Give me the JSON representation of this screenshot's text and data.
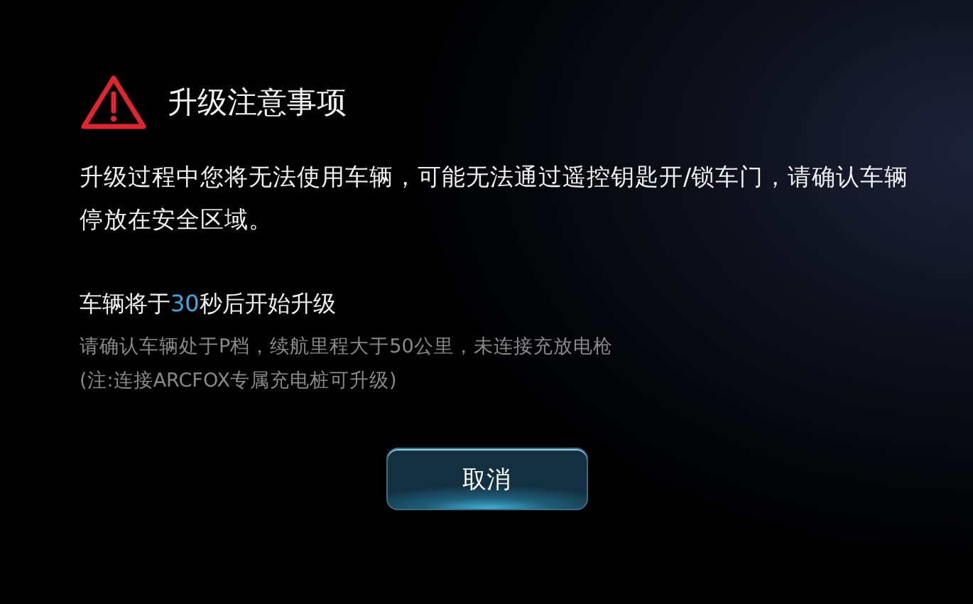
{
  "title": "升级注意事项",
  "message": "升级过程中您将无法使用车辆，可能无法通过遥控钥匙开/锁车门，请确认车辆停放在安全区域。",
  "countdown": {
    "before": "车辆将于",
    "seconds": "30",
    "after": "秒后开始升级"
  },
  "notes": [
    "请确认车辆处于P档，续航里程大于50公里，未连接充放电枪",
    "(注:连接ARCFOX专属充电桩可升级)"
  ],
  "buttons": [
    {
      "label": "取消"
    }
  ]
}
